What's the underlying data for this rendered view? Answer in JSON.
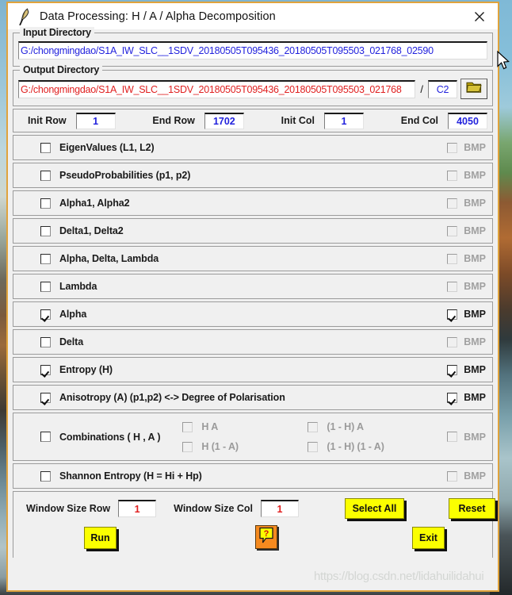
{
  "window": {
    "title": "Data Processing: H / A / Alpha Decomposition",
    "app_icon": "quill-pen-icon",
    "close_label": "✕",
    "frame_color": "#e0a33c"
  },
  "input_directory": {
    "legend": "Input Directory",
    "value": "G:/chongmingdao/S1A_IW_SLC__1SDV_20180505T095436_20180505T095503_021768_02590",
    "text_color": "#2222dd"
  },
  "output_directory": {
    "legend": "Output Directory",
    "value": "G:/chongmingdao/S1A_IW_SLC__1SDV_20180505T095436_20180505T095503_021768",
    "text_color": "#e02020",
    "separator": "/",
    "subfolder": "C2",
    "browse_icon": "folder-icon"
  },
  "range": {
    "init_row_label": "Init Row",
    "init_row_value": "1",
    "end_row_label": "End Row",
    "end_row_value": "1702",
    "init_col_label": "Init Col",
    "init_col_value": "1",
    "end_col_label": "End Col",
    "end_col_value": "4050"
  },
  "bmp_label": "BMP",
  "options": [
    {
      "label": "EigenValues (L1, L2)",
      "checked": false,
      "enabled": true,
      "bmp_checked": false,
      "bmp_enabled": false
    },
    {
      "label": "PseudoProbabilities (p1, p2)",
      "checked": false,
      "enabled": true,
      "bmp_checked": false,
      "bmp_enabled": false
    },
    {
      "label": "Alpha1, Alpha2",
      "checked": false,
      "enabled": true,
      "bmp_checked": false,
      "bmp_enabled": false
    },
    {
      "label": "Delta1, Delta2",
      "checked": false,
      "enabled": true,
      "bmp_checked": false,
      "bmp_enabled": false
    },
    {
      "label": "Alpha, Delta, Lambda",
      "checked": false,
      "enabled": true,
      "bmp_checked": false,
      "bmp_enabled": false
    },
    {
      "label": "Lambda",
      "checked": false,
      "enabled": true,
      "bmp_checked": false,
      "bmp_enabled": false
    },
    {
      "label": "Alpha",
      "checked": true,
      "enabled": true,
      "bmp_checked": true,
      "bmp_enabled": true
    },
    {
      "label": "Delta",
      "checked": false,
      "enabled": true,
      "bmp_checked": false,
      "bmp_enabled": false
    },
    {
      "label": "Entropy  (H)",
      "checked": true,
      "enabled": true,
      "bmp_checked": true,
      "bmp_enabled": true
    },
    {
      "label": "Anisotropy  (A) (p1,p2)   <->    Degree of Polarisation",
      "checked": true,
      "enabled": true,
      "bmp_checked": true,
      "bmp_enabled": true
    }
  ],
  "combinations": {
    "label": "Combinations ( H , A )",
    "checked": false,
    "bmp_checked": false,
    "bmp_enabled": false,
    "items": [
      {
        "label": "H A",
        "checked": false,
        "enabled": false
      },
      {
        "label": "(1 - H) A",
        "checked": false,
        "enabled": false
      },
      {
        "label": "H (1 - A)",
        "checked": false,
        "enabled": false
      },
      {
        "label": "(1 - H) (1 - A)",
        "checked": false,
        "enabled": false
      }
    ]
  },
  "shannon": {
    "label": "Shannon Entropy  (H = Hi + Hp)",
    "checked": false,
    "bmp_checked": false,
    "bmp_enabled": false
  },
  "window_size": {
    "row_label": "Window Size Row",
    "row_value": "1",
    "col_label": "Window Size Col",
    "col_value": "1"
  },
  "buttons": {
    "select_all": "Select All",
    "reset": "Reset",
    "run": "Run",
    "exit": "Exit",
    "help_icon": "question-help-icon",
    "accent_yellow": "#fbff00",
    "accent_orange": "#f58a1f"
  },
  "watermark": "https://blog.csdn.net/lidahuilidahui"
}
